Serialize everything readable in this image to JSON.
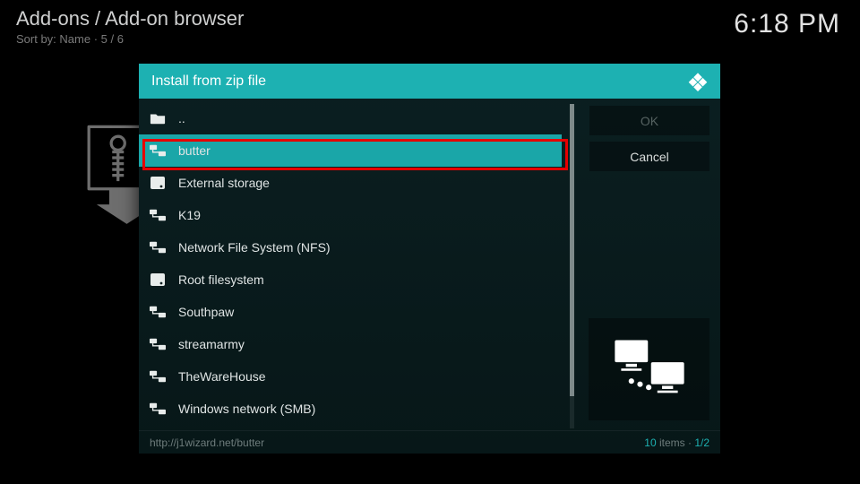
{
  "header": {
    "breadcrumb": "Add-ons / Add-on browser",
    "sort_line": "Sort by: Name  ·  5 / 6",
    "clock": "6:18 PM"
  },
  "dialog": {
    "title": "Install from zip file",
    "items": [
      {
        "label": "..",
        "icon": "folder-up",
        "selected": false
      },
      {
        "label": "butter",
        "icon": "network-share",
        "selected": true
      },
      {
        "label": "External storage",
        "icon": "disk",
        "selected": false
      },
      {
        "label": "K19",
        "icon": "network-share",
        "selected": false
      },
      {
        "label": "Network File System (NFS)",
        "icon": "network-share",
        "selected": false
      },
      {
        "label": "Root filesystem",
        "icon": "disk",
        "selected": false
      },
      {
        "label": "Southpaw",
        "icon": "network-share",
        "selected": false
      },
      {
        "label": "streamarmy",
        "icon": "network-share",
        "selected": false
      },
      {
        "label": "TheWareHouse",
        "icon": "network-share",
        "selected": false
      },
      {
        "label": "Windows network (SMB)",
        "icon": "network-share",
        "selected": false
      }
    ],
    "buttons": {
      "ok": "OK",
      "cancel": "Cancel"
    },
    "footer": {
      "path": "http://j1wizard.net/butter",
      "items_count": "10",
      "items_word": " items · ",
      "page": "1/2"
    }
  }
}
